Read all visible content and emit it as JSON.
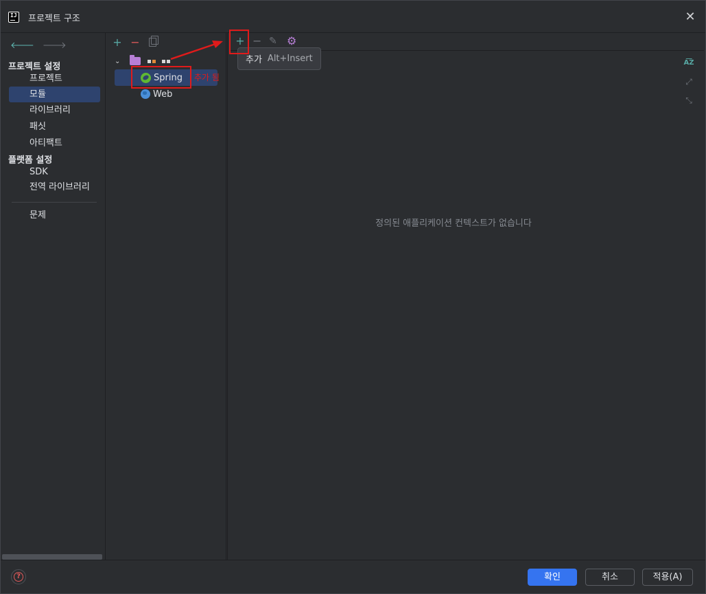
{
  "window": {
    "title": "프로젝트 구조",
    "close_glyph": "✕"
  },
  "nav": {
    "back_glyph": "🡐",
    "forward_glyph": "🡒",
    "section_project": "프로젝트 설정",
    "section_platform": "플랫폼 설정",
    "items": [
      {
        "label": "프로젝트",
        "selected": false
      },
      {
        "label": "모듈",
        "selected": true
      },
      {
        "label": "라이브러리",
        "selected": false
      },
      {
        "label": "패싯",
        "selected": false
      },
      {
        "label": "아티팩트",
        "selected": false
      }
    ],
    "platform_items": [
      {
        "label": "SDK"
      },
      {
        "label": "전역 라이브러리"
      }
    ],
    "problems": "문제"
  },
  "module_toolbar": {
    "add_glyph": "+",
    "remove_glyph": "−"
  },
  "tree": {
    "chevron": "⌄",
    "items": [
      {
        "label": "Spring",
        "icon": "spring-icon",
        "selected": true
      },
      {
        "label": "Web",
        "icon": "web-icon",
        "selected": false
      }
    ]
  },
  "context_toolbar": {
    "add_glyph": "+",
    "remove_glyph": "−",
    "edit_glyph": "✎",
    "settings_glyph": "⚙"
  },
  "tooltip": {
    "label": "추가",
    "shortcut": "Alt+Insert"
  },
  "context_panel": {
    "empty_message": "정의된 애플리케이션 컨텍스트가 없습니다",
    "sort_glyph": "A͞Z",
    "expand_glyph": "⤢",
    "collapse_glyph": "⤡"
  },
  "footer": {
    "help_glyph": "?",
    "ok": "확인",
    "cancel": "취소",
    "apply": "적용(A)"
  },
  "annotation": {
    "text": "추가 됨",
    "color": "#e01b1b"
  },
  "colors": {
    "selection": "#2e436e",
    "primary_button": "#3574f0",
    "add_icon": "#57a8a3",
    "remove_icon": "#e05a5a",
    "gear_icon": "#b77fd6"
  }
}
